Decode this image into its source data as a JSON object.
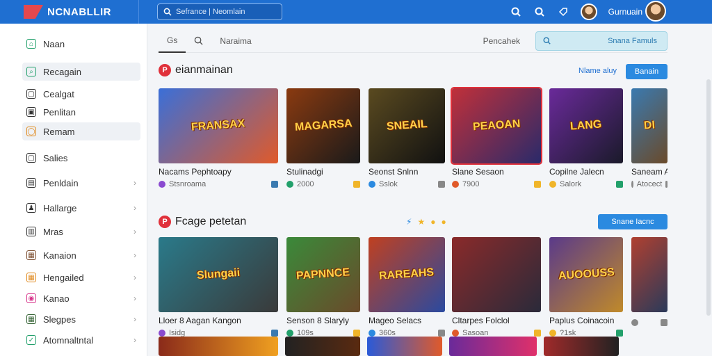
{
  "header": {
    "logo_text": "NCNABLLIR",
    "search_text": "Sefrance | Neomlain",
    "user_name": "Gurnuain",
    "colors": {
      "bar": "#1f6fd1",
      "accent": "#e5484d"
    }
  },
  "sidebar": {
    "items": [
      {
        "label": "Naan",
        "icon": "home-icon",
        "color": "#22a06b",
        "chevron": false
      },
      {
        "label": "Recagain",
        "icon": "search-icon",
        "color": "#22a06b",
        "chevron": false
      },
      {
        "label": "Cealgat",
        "icon": "square-icon",
        "color": "#333333",
        "chevron": false
      },
      {
        "label": "Penlitan",
        "icon": "lock-icon",
        "color": "#333333",
        "chevron": false
      },
      {
        "label": "Remam",
        "icon": "circle-icon",
        "color": "#e08a1e",
        "chevron": false
      },
      {
        "label": "Salies",
        "icon": "square-icon",
        "color": "#333333",
        "chevron": false
      },
      {
        "label": "Penldain",
        "icon": "image-icon",
        "color": "#333333",
        "chevron": true
      },
      {
        "label": "Hallarge",
        "icon": "user-icon",
        "color": "#333333",
        "chevron": true
      },
      {
        "label": "Mras",
        "icon": "chart-icon",
        "color": "#333333",
        "chevron": true
      },
      {
        "label": "Kanaion",
        "icon": "game-icon",
        "color": "#7a4a2b",
        "chevron": true
      },
      {
        "label": "Hengailed",
        "icon": "grid-icon",
        "color": "#e08a1e",
        "chevron": true
      },
      {
        "label": "Kanao",
        "icon": "controller-icon",
        "color": "#d6338a",
        "chevron": true
      },
      {
        "label": "Slegpes",
        "icon": "game-icon",
        "color": "#2e5e2e",
        "chevron": true
      },
      {
        "label": "Atomnaltntal",
        "icon": "check-icon",
        "color": "#22a06b",
        "chevron": true
      }
    ]
  },
  "tabs": {
    "items": [
      "Gs",
      "Naraima"
    ],
    "right_label": "Pencahek",
    "search_label": "Snana Famuls"
  },
  "section1": {
    "title": "eianmainan",
    "link": "Nlame aluy",
    "button": "Banain",
    "cards": [
      {
        "title": "Nacams Pephtoapy",
        "thumb_text": "FRANSAX",
        "meta": "Stsnroama",
        "bg1": "#3a6fd8",
        "bg2": "#e05a2a"
      },
      {
        "title": "Stulinadgi",
        "thumb_text": "MAGARSA",
        "meta": "2000",
        "bg1": "#8a3a10",
        "bg2": "#1a1a1a"
      },
      {
        "title": "Seonst Snlnn",
        "thumb_text": "SNEAIL",
        "meta": "Sslok",
        "bg1": "#5a4a20",
        "bg2": "#111111"
      },
      {
        "title": "Slane Sesaon",
        "thumb_text": "PEAOAN",
        "meta": "7900",
        "bg1": "#c0303a",
        "bg2": "#2a2a6a"
      },
      {
        "title": "Copilne Jalecn",
        "thumb_text": "LANG",
        "meta": "Salork",
        "bg1": "#6a2a9a",
        "bg2": "#1a1a2a"
      },
      {
        "title": "Saneam A",
        "thumb_text": "DI",
        "meta": "Atocect",
        "bg1": "#3a7ab0",
        "bg2": "#6a4a2a"
      }
    ]
  },
  "section2": {
    "title": "Fcage petetan",
    "button": "Snane Iacnc",
    "cards": [
      {
        "title": "Lloer 8 Aagan Kangon",
        "thumb_text": "Slungaii",
        "meta": "Isidg",
        "bg1": "#2a7a8a",
        "bg2": "#3a3a3a"
      },
      {
        "title": "Senson 8 Slaryly",
        "thumb_text": "PAPNNCE",
        "meta": "109s",
        "bg1": "#3a8a3a",
        "bg2": "#6a4a2a"
      },
      {
        "title": "Mageo Selacs",
        "thumb_text": "RAREAHS",
        "meta": "360s",
        "bg1": "#c04020",
        "bg2": "#2a4aa0"
      },
      {
        "title": "Cltarpes Folclol",
        "thumb_text": "",
        "meta": "Sasoan",
        "bg1": "#8a2a2a",
        "bg2": "#2a2a3a"
      },
      {
        "title": "Paplus Coinacoin",
        "thumb_text": "AUOOUSS",
        "meta": "?1sk",
        "bg1": "#5a3a8a",
        "bg2": "#c08a2a"
      },
      {
        "title": "",
        "thumb_text": "",
        "meta": "",
        "bg1": "#b04030",
        "bg2": "#2a3a5a"
      }
    ]
  }
}
